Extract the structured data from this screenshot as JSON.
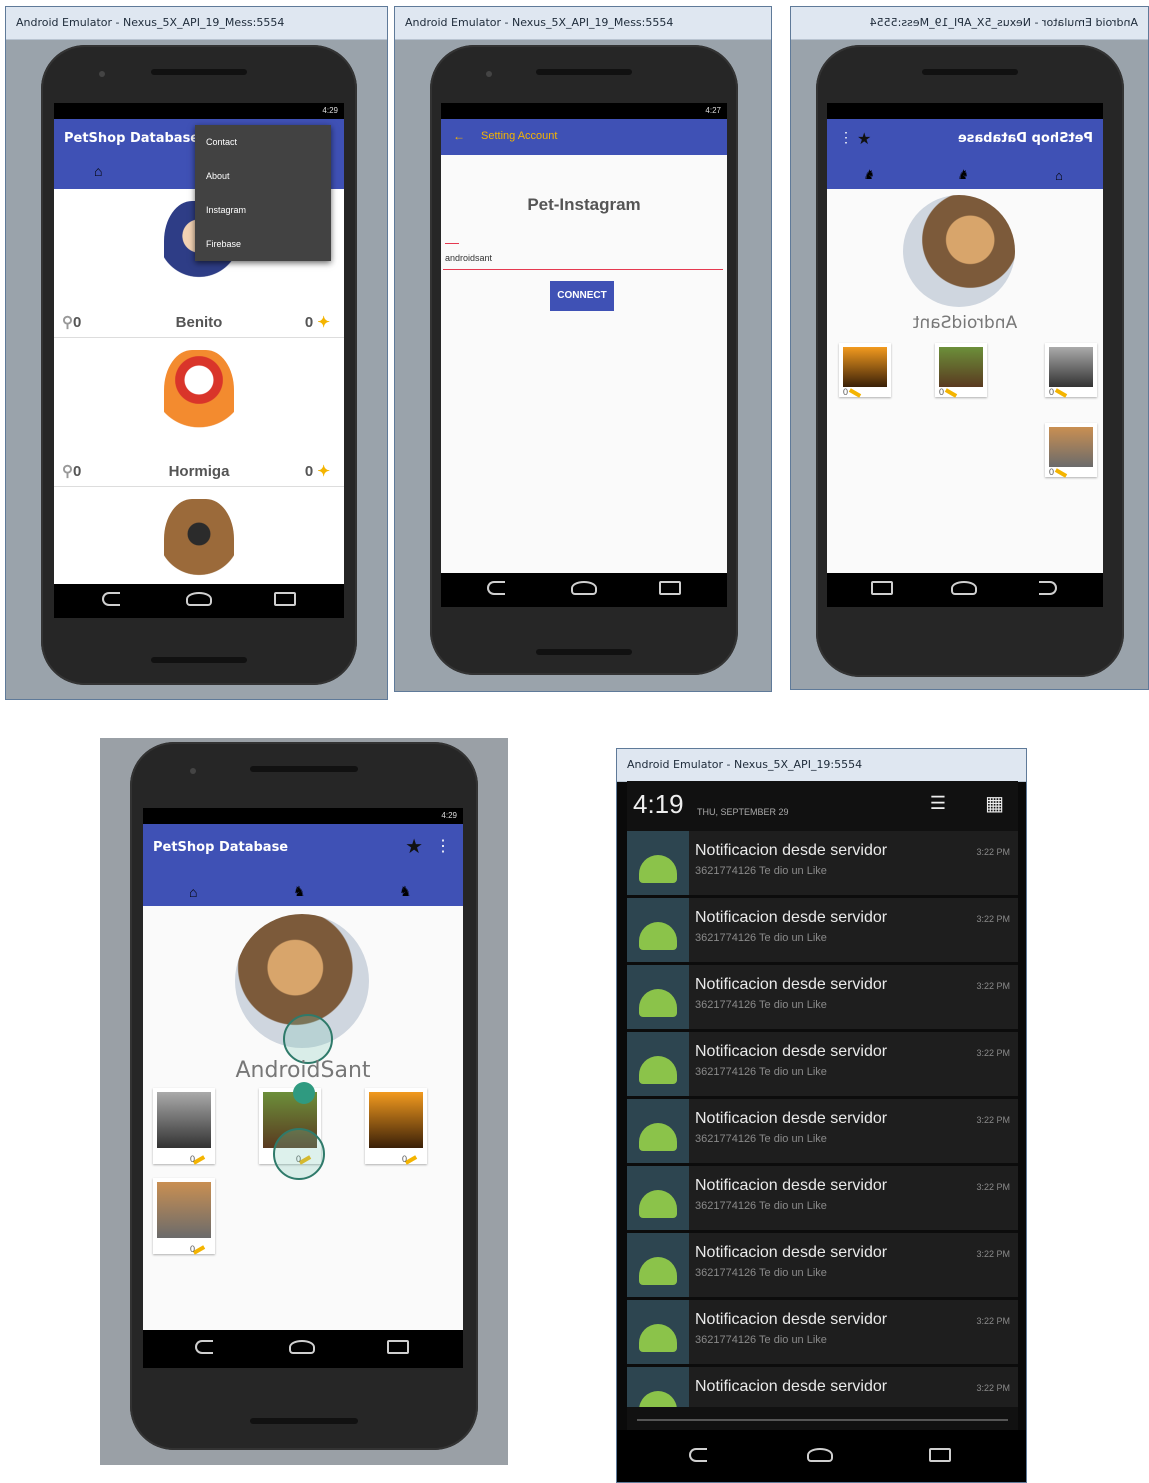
{
  "colors": {
    "primary": "#3f51b5",
    "accent": "#f4b400",
    "notif_icon_bg": "#2d4550",
    "android_green": "#8bc34a"
  },
  "panel1": {
    "window_title": "Android Emulator - Nexus_5X_API_19_Mess:5554",
    "status": "4:29",
    "app_title": "PetShop Database",
    "menu_items": [
      "Contact",
      "About",
      "Instagram",
      "Firebase"
    ],
    "cards": [
      {
        "name": "Benito",
        "bones": "0",
        "likes": "0"
      },
      {
        "name": "Hormiga",
        "bones": "0",
        "likes": "0"
      }
    ]
  },
  "panel2": {
    "window_title": "Android Emulator - Nexus_5X_API_19_Mess:5554",
    "status": "4:27",
    "toolbar_title": "Setting Account",
    "heading": "Pet-Instagram",
    "input_value": "androidsant",
    "connect_label": "CONNECT"
  },
  "panel3": {
    "window_title": "Android Emulator - Nexus_5X_API_19_Mess:5554",
    "app_title": "PetShop Database",
    "username": "AndroidSant",
    "likes": [
      "0",
      "0",
      "0",
      "0"
    ]
  },
  "panel4": {
    "status": "4:29",
    "app_title": "PetShop Database",
    "username": "AndroidSant",
    "likes": [
      "0",
      "0",
      "0",
      "0"
    ]
  },
  "panel5": {
    "window_title": "Android Emulator - Nexus_5X_API_19:5554",
    "clock": "4:19",
    "date": "THU, SEPTEMBER 29",
    "notifications": [
      {
        "title": "Notificacion desde servidor",
        "text": "3621774126 Te dio un Like",
        "time": "3:22 PM"
      },
      {
        "title": "Notificacion desde servidor",
        "text": "3621774126 Te dio un Like",
        "time": "3:22 PM"
      },
      {
        "title": "Notificacion desde servidor",
        "text": "3621774126 Te dio un Like",
        "time": "3:22 PM"
      },
      {
        "title": "Notificacion desde servidor",
        "text": "3621774126 Te dio un Like",
        "time": "3:22 PM"
      },
      {
        "title": "Notificacion desde servidor",
        "text": "3621774126 Te dio un Like",
        "time": "3:22 PM"
      },
      {
        "title": "Notificacion desde servidor",
        "text": "3621774126 Te dio un Like",
        "time": "3:22 PM"
      },
      {
        "title": "Notificacion desde servidor",
        "text": "3621774126 Te dio un Like",
        "time": "3:22 PM"
      },
      {
        "title": "Notificacion desde servidor",
        "text": "3621774126 Te dio un Like",
        "time": "3:22 PM"
      },
      {
        "title": "Notificacion desde servidor",
        "text": "",
        "time": "3:22 PM"
      }
    ]
  }
}
